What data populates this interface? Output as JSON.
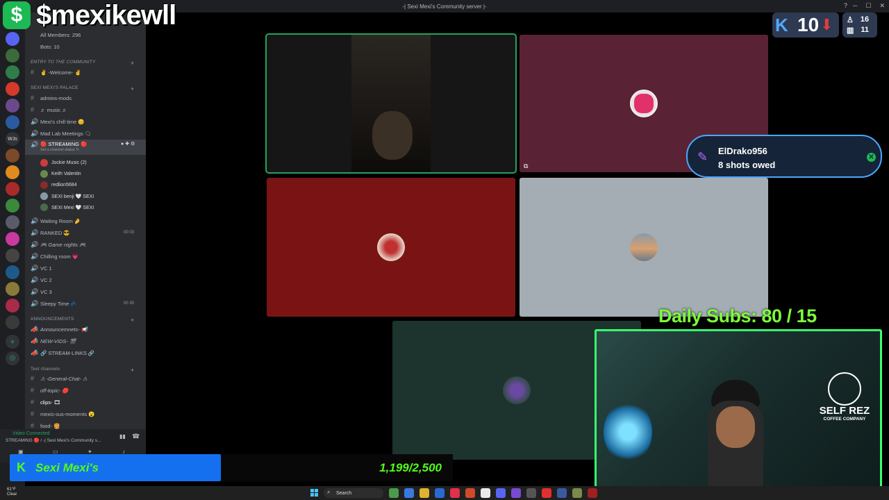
{
  "window": {
    "title": "-| Sexi Mexi's Community server |-"
  },
  "overlay": {
    "handle": "$mexikewll",
    "kick_count": "10",
    "mini_stats": {
      "up": "16",
      "bars": "11"
    },
    "notification": {
      "name": "ElDrako956",
      "message": "8 shots owed"
    },
    "daily_subs": "Daily Subs: 80 / 15",
    "bottom_bar_text": "Sexi Mexi's",
    "goal_text": "1,199/2,500",
    "sponsor": {
      "title": "SELF REZ",
      "subtitle": "COFFEE COMPANY"
    }
  },
  "sidebar": {
    "members": "All Members: 296",
    "bots": "Bots: 10",
    "categories": {
      "entry": "ENTRY TO THE COMMUNITY",
      "palace": "SEXI MEXI'S PALACE",
      "announcements": "ANNOUNCEMENTS",
      "text": "Text channels"
    },
    "channels": {
      "welcome": "✌ -Welcome- ✌",
      "admins": "admins-mods",
      "music": "♬ music ♬",
      "chill": "Mexi's chill time 😊",
      "madlab": "Mad Lab Meetings 🗨",
      "streaming": "🔴 STREAMING 🔴",
      "streaming_status": "Set a channel status ✎",
      "waiting": "Waiting Room 🤌",
      "ranked": "RANKED 😎",
      "ranked_count": "00 03",
      "game_nights": "🎮 Game nights 🎮",
      "chilling": "Chilling room 💗",
      "vc1": "VC 1",
      "vc2": "VC 2",
      "vc3": "VC 3",
      "sleepy": "Sleepy Time 💤",
      "sleepy_count": "00 30",
      "announcements_ch": "Announcemnets- 📢",
      "new_vids": "NEW-VIDS- 🎬",
      "stream_links": "🔗 STREAM-LINKS 🔗",
      "general": "⚠ -General-Chat- ⚠",
      "off_topic": "off-topic- 🔴",
      "clips": "clips- 🎞",
      "sus": "mexis-sus-moments 😮",
      "food": "food- 🍔"
    },
    "voice_users": [
      {
        "name": "Jockie Music (2)",
        "color": "#c93d3d"
      },
      {
        "name": "Keith Valentin",
        "color": "#6a8a4a"
      },
      {
        "name": "redlion5684",
        "color": "#8a2a2a"
      },
      {
        "name": "SEXI benji 🤍 SEXI",
        "color": "#8899aa"
      },
      {
        "name": "SEXI Mexi 🤍 SEXI",
        "color": "#4a6a4a"
      }
    ],
    "voice_status": "Video Connected",
    "voice_channel": "STREAMING 🔴 / -| Sexi Mexi's Community s..."
  },
  "taskbar": {
    "weather_temp": "61°F",
    "weather_desc": "Clear",
    "search_placeholder": "Search"
  },
  "colors": {
    "tile_green_border": "#23a55a",
    "tile_maroon": "#5a2235",
    "tile_red": "#7a1414",
    "tile_gray": "#a4adb3",
    "tile_teal": "#1d332d",
    "accent_green": "#53fc18"
  }
}
